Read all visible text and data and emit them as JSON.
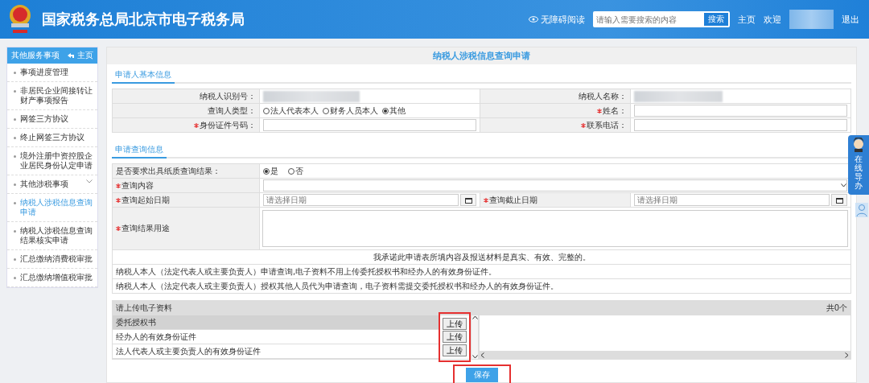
{
  "header": {
    "title": "国家税务总局北京市电子税务局",
    "accessibility": "无障碍阅读",
    "search": {
      "placeholder": "请输入需要搜索的内容",
      "button": "搜索"
    },
    "links": [
      {
        "label": "主页"
      },
      {
        "label": "欢迎"
      },
      {
        "label": "退出"
      }
    ]
  },
  "sidebar": {
    "title": "其他服务事项",
    "home": "主页",
    "items": [
      {
        "label": "事项进度管理",
        "kind": "item",
        "selected": false
      },
      {
        "label": "非居民企业间接转让财产事项报告",
        "kind": "item",
        "selected": false
      },
      {
        "label": "网签三方协议",
        "kind": "item",
        "selected": false
      },
      {
        "label": "终止网签三方协议",
        "kind": "item",
        "selected": false
      },
      {
        "label": "境外注册中资控股企业居民身份认定申请",
        "kind": "item",
        "selected": false
      },
      {
        "label": "其他涉税事项",
        "kind": "group",
        "selected": false
      },
      {
        "label": "纳税人涉税信息查询申请",
        "kind": "item",
        "selected": true
      },
      {
        "label": "纳税人涉税信息查询结果核实申请",
        "kind": "item",
        "selected": false
      },
      {
        "label": "汇总缴纳消费税审批",
        "kind": "item",
        "selected": false
      },
      {
        "label": "汇总缴纳增值税审批",
        "kind": "item",
        "selected": false
      }
    ]
  },
  "page_title": "纳税人涉税信息查询申请",
  "applicant": {
    "tab": "申请人基本信息",
    "taxpayer_id_label": "纳税人识别号：",
    "taxpayer_name_label": "纳税人名称：",
    "type_label": "查询人类型：",
    "type_options": [
      {
        "label": "法人代表本人",
        "selected": false
      },
      {
        "label": "财务人员本人",
        "selected": false
      },
      {
        "label": "其他",
        "selected": true
      }
    ],
    "name_label": {
      "text": "姓名：",
      "required": true
    },
    "id_number_label": {
      "text": "身份证件号码：",
      "required": true
    },
    "phone_label": {
      "text": "联系电话：",
      "required": true
    }
  },
  "query": {
    "tab": "申请查询信息",
    "paper_label": "是否要求出具纸质查询结果：",
    "paper_options": [
      {
        "label": "是",
        "selected": true
      },
      {
        "label": "否",
        "selected": false
      }
    ],
    "content_label": {
      "text": "查询内容",
      "required": true
    },
    "start_label": {
      "text": "查询起始日期",
      "required": true
    },
    "start_placeholder": "请选择日期",
    "end_label": {
      "text": "查询截止日期",
      "required": true
    },
    "end_placeholder": "请选择日期",
    "purpose_label": {
      "text": "查询结果用途",
      "required": true
    },
    "statement": "我承诺此申请表所填内容及报送材料是真实、有效、完整的。",
    "notes": [
      "纳税人本人（法定代表人或主要负责人）申请查询,电子资料不用上传委托授权书和经办人的有效身份证件。",
      "纳税人本人（法定代表人或主要负责人）授权其他人员代为申请查询，电子资料需提交委托授权书和经办人的有效身份证件。"
    ]
  },
  "upload": {
    "title": "请上传电子资料",
    "count": "共0个",
    "items": [
      {
        "label": "委托授权书",
        "selected": true,
        "button": "上传"
      },
      {
        "label": "经办人的有效身份证件",
        "selected": false,
        "button": "上传"
      },
      {
        "label": "法人代表人或主要负责人的有效身份证件",
        "selected": false,
        "button": "上传"
      }
    ]
  },
  "save": "保存",
  "guide": {
    "label": "在线导办"
  }
}
